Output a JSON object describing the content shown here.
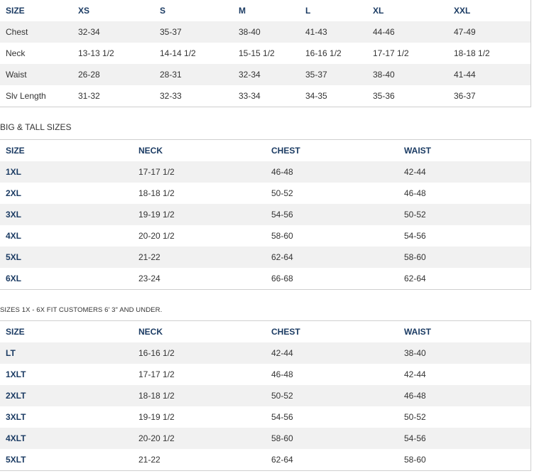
{
  "table1": {
    "headers": [
      "SIZE",
      "XS",
      "S",
      "M",
      "L",
      "XL",
      "XXL"
    ],
    "rows": [
      [
        "Chest",
        "32-34",
        "35-37",
        "38-40",
        "41-43",
        "44-46",
        "47-49"
      ],
      [
        "Neck",
        "13-13 1/2",
        "14-14 1/2",
        "15-15 1/2",
        "16-16 1/2",
        "17-17 1/2",
        "18-18 1/2"
      ],
      [
        "Waist",
        "26-28",
        "28-31",
        "32-34",
        "35-37",
        "38-40",
        "41-44"
      ],
      [
        "Slv Length",
        "31-32",
        "32-33",
        "33-34",
        "34-35",
        "35-36",
        "36-37"
      ]
    ]
  },
  "big_tall_heading": "BIG & TALL SIZES",
  "table2": {
    "headers": [
      "SIZE",
      "NECK",
      "CHEST",
      "WAIST"
    ],
    "rows": [
      [
        "1XL",
        "17-17 1/2",
        "46-48",
        "42-44"
      ],
      [
        "2XL",
        "18-18 1/2",
        "50-52",
        "46-48"
      ],
      [
        "3XL",
        "19-19 1/2",
        "54-56",
        "50-52"
      ],
      [
        "4XL",
        "20-20 1/2",
        "58-60",
        "54-56"
      ],
      [
        "5XL",
        "21-22",
        "62-64",
        "58-60"
      ],
      [
        "6XL",
        "23-24",
        "66-68",
        "62-64"
      ]
    ]
  },
  "fit_note": "SIZES 1X - 6X FIT CUSTOMERS 6' 3\" AND UNDER.",
  "table3": {
    "headers": [
      "SIZE",
      "NECK",
      "CHEST",
      "WAIST"
    ],
    "rows": [
      [
        "LT",
        "16-16 1/2",
        "42-44",
        "38-40"
      ],
      [
        "1XLT",
        "17-17 1/2",
        "46-48",
        "42-44"
      ],
      [
        "2XLT",
        "18-18 1/2",
        "50-52",
        "46-48"
      ],
      [
        "3XLT",
        "19-19 1/2",
        "54-56",
        "50-52"
      ],
      [
        "4XLT",
        "20-20 1/2",
        "58-60",
        "54-56"
      ],
      [
        "5XLT",
        "21-22",
        "62-64",
        "58-60"
      ]
    ]
  }
}
